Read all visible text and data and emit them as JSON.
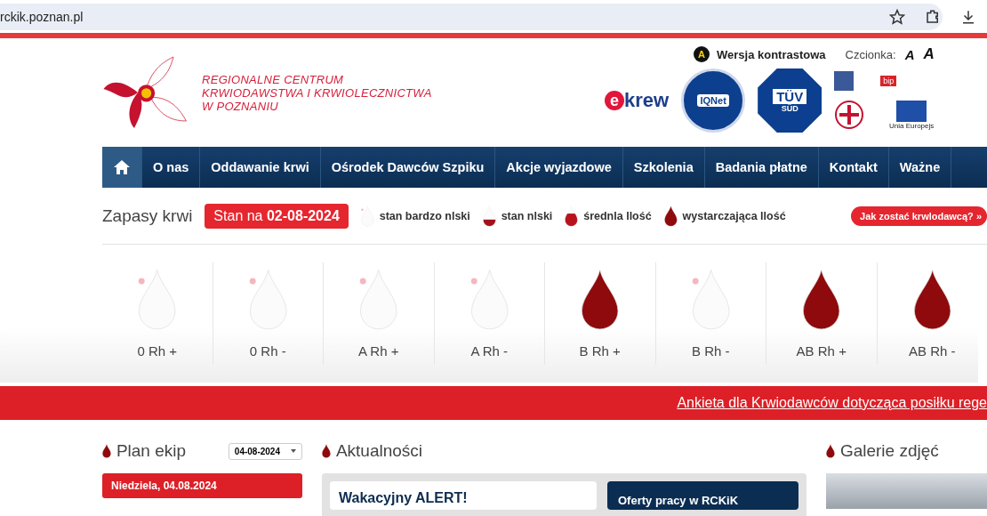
{
  "browser": {
    "url": "rckik.poznan.pl"
  },
  "header": {
    "logo_lines": [
      "REGIONALNE CENTRUM",
      "KRWIODAWSTWA I KRWIOLECZNICTWA",
      "W POZNANIU"
    ],
    "contrast": {
      "badge": "A",
      "label": "Wersja kontrastowa"
    },
    "font_label": "Czcionka:",
    "font_sizes": [
      "A",
      "A"
    ],
    "ekrew": {
      "e": "e",
      "rest": "krew"
    },
    "iqnet": "IQNet",
    "tuv": [
      "TÜV",
      "SÜD"
    ],
    "bip": "bip",
    "eu": "Unia Europejs"
  },
  "nav": [
    {
      "kind": "home",
      "selected": true
    },
    {
      "kind": "link",
      "label": "O nas",
      "selected": false
    },
    {
      "kind": "link",
      "label": "Oddawanie krwi",
      "selected": false
    },
    {
      "kind": "link",
      "label": "Ośrodek Dawców Szpiku",
      "selected": false
    },
    {
      "kind": "link",
      "label": "Akcje wyjazdowe",
      "selected": false
    },
    {
      "kind": "link",
      "label": "Szkolenia",
      "selected": false
    },
    {
      "kind": "link",
      "label": "Badania płatne",
      "selected": false
    },
    {
      "kind": "link",
      "label": "Kontakt",
      "selected": false
    },
    {
      "kind": "link",
      "label": "Ważne",
      "selected": false
    }
  ],
  "supplies": {
    "title": "Zapasy krwi",
    "date_prefix": "Stan na ",
    "date": "02-08-2024",
    "legend": [
      {
        "kind": "very_low",
        "label": "stan bardzo nlski"
      },
      {
        "kind": "low",
        "label": "stan nlski"
      },
      {
        "kind": "medium",
        "label": "średnla llość"
      },
      {
        "kind": "sufficient",
        "label": "wystarczająca llość"
      }
    ],
    "cta": "Jak zostać krwlodawcą? »",
    "groups": [
      {
        "label": "0 Rh +",
        "kind": "very_low"
      },
      {
        "label": "0 Rh -",
        "kind": "very_low"
      },
      {
        "label": "A Rh +",
        "kind": "very_low"
      },
      {
        "label": "A Rh -",
        "kind": "very_low"
      },
      {
        "label": "B Rh +",
        "kind": "sufficient"
      },
      {
        "label": "B Rh -",
        "kind": "very_low"
      },
      {
        "label": "AB Rh +",
        "kind": "sufficient"
      },
      {
        "label": "AB Rh -",
        "kind": "sufficient"
      }
    ]
  },
  "banner": {
    "link": "Ankieta dla Krwiodawców dotycząca posiłku rege"
  },
  "plan": {
    "title": "Plan ekip",
    "date_select": "04-08-2024",
    "day": "Niedziela, 04.08.2024"
  },
  "news": {
    "title": "Aktualności",
    "card": "Wakacyjny ALERT!",
    "side": "Oferty pracy w RCKiK"
  },
  "gallery": {
    "title": "Galerie zdjęć"
  }
}
